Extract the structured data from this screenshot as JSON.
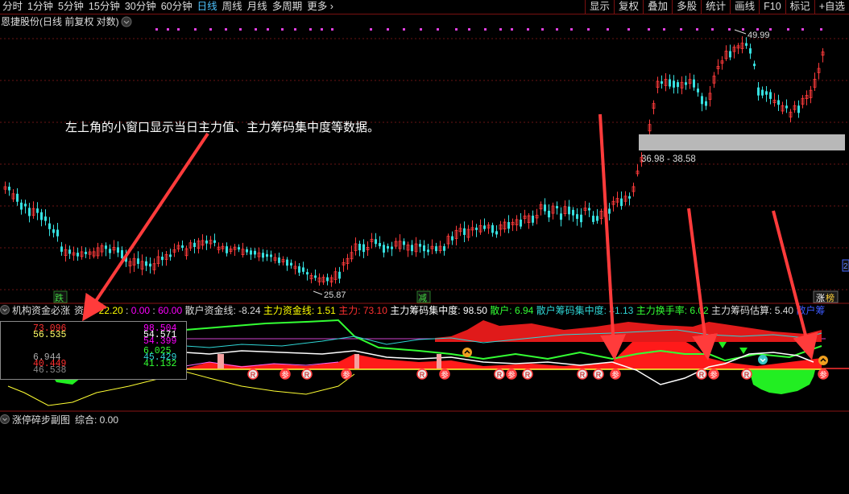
{
  "toolbar": {
    "tabs": [
      {
        "label": "分时",
        "active": false
      },
      {
        "label": "1分钟",
        "active": false
      },
      {
        "label": "5分钟",
        "active": false
      },
      {
        "label": "15分钟",
        "active": false
      },
      {
        "label": "30分钟",
        "active": false
      },
      {
        "label": "60分钟",
        "active": false
      },
      {
        "label": "日线",
        "active": true
      },
      {
        "label": "周线",
        "active": false
      },
      {
        "label": "月线",
        "active": false
      },
      {
        "label": "多周期",
        "active": false
      },
      {
        "label": "更多",
        "active": false
      }
    ],
    "tools": [
      "显示",
      "复权",
      "叠加",
      "多股",
      "统计",
      "画线",
      "F10",
      "标记",
      "+自选"
    ]
  },
  "price_pane": {
    "title": "恩捷股份(日线 前复权 对数)",
    "annotation": "左上角的小窗口显示当日主力值、主力筹码集中度等数据。",
    "high_label": "49.99",
    "low_label": "25.87",
    "zone_label": "36.98 - 38.58",
    "marker_die": "跌",
    "marker_jian": "减",
    "marker_zhang": "涨",
    "marker_bang": "榜",
    "right_edge_label": "2"
  },
  "indicator": {
    "name": "机构资金必涨",
    "labels": [
      {
        "text": "资金:",
        "color": "#dddddd"
      },
      {
        "text": "22.20",
        "color": "#ffff00"
      },
      {
        "text": ":",
        "color": "#dddddd"
      },
      {
        "text": "0.00",
        "color": "#ff00ff"
      },
      {
        "text": ":",
        "color": "#dddddd"
      },
      {
        "text": "60.00",
        "color": "#ff00ff"
      },
      {
        "text": "散户资金线: -8.24",
        "color": "#dddddd"
      },
      {
        "text": "主力资金线: 1.51",
        "color": "#ffff00"
      },
      {
        "text": "主力: 73.10",
        "color": "#ff3030"
      },
      {
        "text": "主力筹码集中度: 98.50",
        "color": "#ffffff"
      },
      {
        "text": "散户: 6.94",
        "color": "#33ff33"
      },
      {
        "text": "散户筹码集中度: 41.13",
        "color": "#2fd6d6"
      },
      {
        "text": "主力换手率: 6.02",
        "color": "#33ff33"
      },
      {
        "text": "主力筹码估算: 5.40",
        "color": "#dddddd"
      },
      {
        "text": "散户筹",
        "color": "#3d5bff"
      }
    ]
  },
  "mini_window": {
    "left": [
      {
        "text": "73.096",
        "color": "#ff3030"
      },
      {
        "text": "56.535",
        "color": "#ffff66"
      },
      {
        "text": "6.944",
        "color": "#aaaaaa"
      },
      {
        "text": "40.449",
        "color": "#ff3030"
      },
      {
        "text": "46.538",
        "color": "#888888"
      }
    ],
    "right": [
      {
        "text": "98.504",
        "color": "#ff00ff"
      },
      {
        "text": "54.571",
        "color": "#ffffff"
      },
      {
        "text": "54.399",
        "color": "#ff00ff"
      },
      {
        "text": "6.025",
        "color": "#33ff33"
      },
      {
        "text": "45.429",
        "color": "#2fd6d6"
      },
      {
        "text": "41.132",
        "color": "#33ff33"
      }
    ]
  },
  "bottom_pane": {
    "name": "涨停碎步副图",
    "score": "综合: 0.00"
  },
  "signals": {
    "r": "R",
    "can": "参"
  }
}
